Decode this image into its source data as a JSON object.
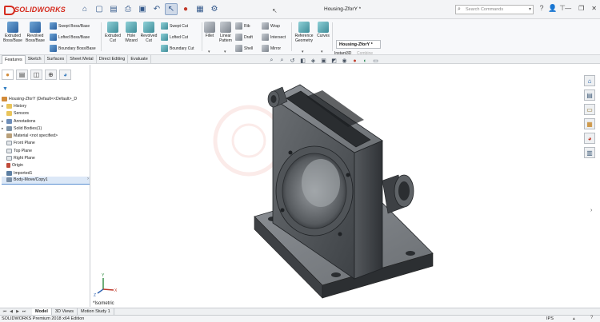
{
  "app": {
    "brand": "SOLIDWORKS",
    "document_title": "Housing-ZforY *"
  },
  "search": {
    "placeholder": "Search Commands"
  },
  "ribbon": {
    "extruded_boss": "Extruded Boss/Base",
    "revolved_boss": "Revolved Boss/Base",
    "swept_boss": "Swept Boss/Base",
    "lofted_boss": "Lofted Boss/Base",
    "boundary_boss": "Boundary Boss/Base",
    "extruded_cut": "Extruded Cut",
    "hole_wizard": "Hole Wizard",
    "revolved_cut": "Revolved Cut",
    "swept_cut": "Swept Cut",
    "lofted_cut": "Lofted Cut",
    "boundary_cut": "Boundary Cut",
    "fillet": "Fillet",
    "linear_pattern": "Linear Pattern",
    "rib": "Rib",
    "draft": "Draft",
    "shell": "Shell",
    "wrap": "Wrap",
    "intersect": "Intersect",
    "mirror": "Mirror",
    "reference_geometry": "Reference Geometry",
    "curves": "Curves",
    "instant3d": "Instant3D",
    "combine": "Combine",
    "tooltip_title": "Housing-ZforY *"
  },
  "tabs": [
    "Features",
    "Sketch",
    "Surfaces",
    "Sheet Metal",
    "Direct Editing",
    "Evaluate"
  ],
  "tree": {
    "root": "Housing-ZforY  (Default<<Default>_D",
    "items": [
      "History",
      "Sensors",
      "Annotations",
      "Solid Bodies(1)",
      "Material <not specified>",
      "Front Plane",
      "Top Plane",
      "Right Plane",
      "Origin",
      "Imported1",
      "Body-Move/Copy1"
    ]
  },
  "graphics": {
    "view_label": "*Isometric",
    "triad_x": "X",
    "triad_y": "Y",
    "triad_z": "Z"
  },
  "bottom_tabs": [
    "Model",
    "3D Views",
    "Motion Study 1"
  ],
  "status": {
    "edition": "SOLIDWORKS Premium 2018 x64 Edition",
    "units": "IPS"
  },
  "colors": {
    "brand_red": "#d52b1e",
    "selection_blue": "#dce8f7",
    "part_body": "#5b5f63"
  }
}
